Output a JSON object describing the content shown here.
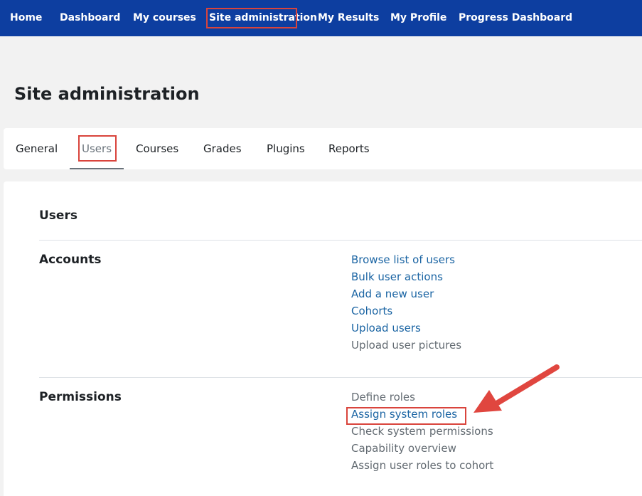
{
  "nav": {
    "items": [
      {
        "label": "Home"
      },
      {
        "label": "Dashboard"
      },
      {
        "label": "My courses"
      },
      {
        "label": "Site administration"
      },
      {
        "label": "My Results"
      },
      {
        "label": "My Profile"
      },
      {
        "label": "Progress Dashboard"
      }
    ],
    "active_index": 3
  },
  "page": {
    "title": "Site administration"
  },
  "tabs": {
    "items": [
      {
        "label": "General"
      },
      {
        "label": "Users"
      },
      {
        "label": "Courses"
      },
      {
        "label": "Grades"
      },
      {
        "label": "Plugins"
      },
      {
        "label": "Reports"
      }
    ],
    "active_index": 1
  },
  "content": {
    "section_title": "Users",
    "accounts": {
      "heading": "Accounts",
      "links": [
        {
          "label": "Browse list of users"
        },
        {
          "label": "Bulk user actions"
        },
        {
          "label": "Add a new user"
        },
        {
          "label": "Cohorts"
        },
        {
          "label": "Upload users"
        },
        {
          "label": "Upload user pictures"
        }
      ]
    },
    "permissions": {
      "heading": "Permissions",
      "links": [
        {
          "label": "Define roles"
        },
        {
          "label": "Assign system roles"
        },
        {
          "label": "Check system permissions"
        },
        {
          "label": "Capability overview"
        },
        {
          "label": "Assign user roles to cohort"
        }
      ]
    }
  },
  "colors": {
    "nav_bg": "#0d3ea0",
    "link": "#1a64a3",
    "muted_link": "#636b72",
    "highlight": "#d9443c",
    "arrow": "#e0463f"
  }
}
